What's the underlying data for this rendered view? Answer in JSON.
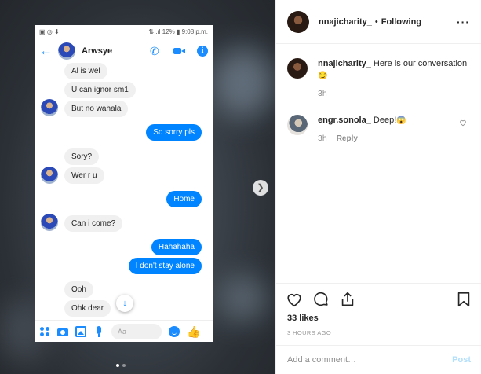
{
  "media": {
    "status_bar": {
      "left_icons": "▣ ◎ ⬇",
      "right_text": "⇅ .ıl 12% ▮ 9:08 p.m."
    },
    "chat": {
      "contact_name": "Arwsye",
      "messages": [
        {
          "side": "in",
          "text": "Al is wel"
        },
        {
          "side": "in",
          "text": "U can ignor sm1"
        },
        {
          "side": "in",
          "text": "But no wahala"
        },
        {
          "side": "out",
          "text": "So sorry pls"
        },
        {
          "side": "in",
          "text": "Sory?"
        },
        {
          "side": "in",
          "text": "Wer r u"
        },
        {
          "side": "out",
          "text": "Home"
        },
        {
          "side": "in",
          "text": "Can i come?"
        },
        {
          "side": "out",
          "text": "Hahahaha"
        },
        {
          "side": "out",
          "text": "I don't stay alone"
        },
        {
          "side": "in",
          "text": "Ooh"
        },
        {
          "side": "in",
          "text": "Ohk dear"
        }
      ],
      "input_placeholder": "Aa"
    },
    "carousel": {
      "slide_count": 2,
      "active_index": 0
    }
  },
  "post": {
    "username": "nnajicharity_",
    "separator": "•",
    "follow_status": "Following",
    "more_label": "···",
    "caption": {
      "username": "nnajicharity_",
      "text": "Here is our conversation",
      "emoji": "😏",
      "time": "3h"
    },
    "comments": [
      {
        "username": "engr.sonola_",
        "text": "Deep!",
        "emoji": "😱",
        "time": "3h",
        "reply_label": "Reply"
      }
    ],
    "likes": "33 likes",
    "posted_ago": "3 HOURS AGO",
    "add_comment_placeholder": "Add a comment…",
    "post_button": "Post"
  }
}
